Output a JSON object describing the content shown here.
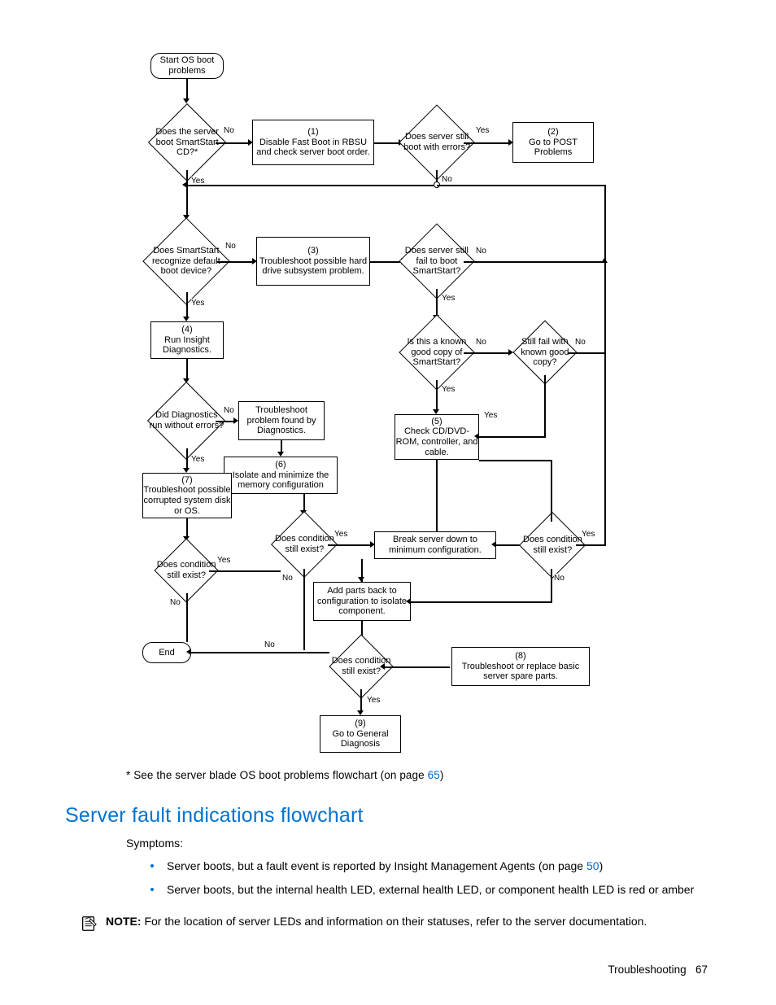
{
  "flow": {
    "start": "Start OS boot problems",
    "n_boot_smartstart": "Does the server boot SmartStart CD?*",
    "n_disable_fastboot": "(1)\nDisable Fast Boot in RBSU and check server boot order.",
    "n_still_boot_errors": "Does server still boot with errors?",
    "n_goto_post": "(2)\nGo to POST Problems",
    "n_recognize_device": "Does SmartStart recognize default boot device?",
    "n_troubleshoot_hdd": "(3)\nTroubleshoot possible hard drive subsystem problem.",
    "n_fail_boot_ss": "Does server still fail to boot SmartStart?",
    "n_run_insight": "(4)\nRun Insight Diagnostics.",
    "n_known_good": "Is this a known good copy of SmartStart?",
    "n_still_fail_known": "Still fail with known good copy?",
    "n_diag_no_err": "Did Diagnostics run without errors?",
    "n_trouble_diag": "Troubleshoot problem found by Diagnostics.",
    "n_isolate_mem": "(6)\nIsolate and minimize the memory configuration",
    "n_check_cd": "(5)\nCheck CD/DVD-ROM, controller, and cable.",
    "n_trouble_os": "(7)\nTroubleshoot possible corrupted system disk or OS.",
    "n_cond_exist_1": "Does condition still exist?",
    "n_break_min": "Break server down to minimum configuration.",
    "n_cond_exist_2": "Does condition still exist?",
    "n_cond_exist_left": "Does condition still exist?",
    "n_add_parts": "Add parts back to configuration to isolate component.",
    "n_end": "End",
    "n_cond_exist_3": "Does condition still exist?",
    "n_trouble_spare": "(8)\nTroubleshoot or replace basic server spare parts.",
    "n_goto_general": "(9)\nGo to General Diagnosis",
    "yes": "Yes",
    "no": "No"
  },
  "footnote": {
    "prefix": "* See the server blade OS boot problems flowchart (on page ",
    "page": "65",
    "suffix": ")"
  },
  "section_title": "Server fault indications flowchart",
  "symptoms_label": "Symptoms:",
  "bullets": [
    {
      "pre": "Server boots, but a fault event is reported by Insight Management Agents (on page ",
      "link": "50",
      "post": ")"
    },
    {
      "pre": "Server boots, but the internal health LED, external health LED, or component health LED is red or amber",
      "link": "",
      "post": ""
    }
  ],
  "note": {
    "bold": "NOTE:",
    "text": "  For the location of server LEDs and information on their statuses, refer to the server documentation."
  },
  "footer": {
    "section": "Troubleshooting",
    "page": "67"
  }
}
